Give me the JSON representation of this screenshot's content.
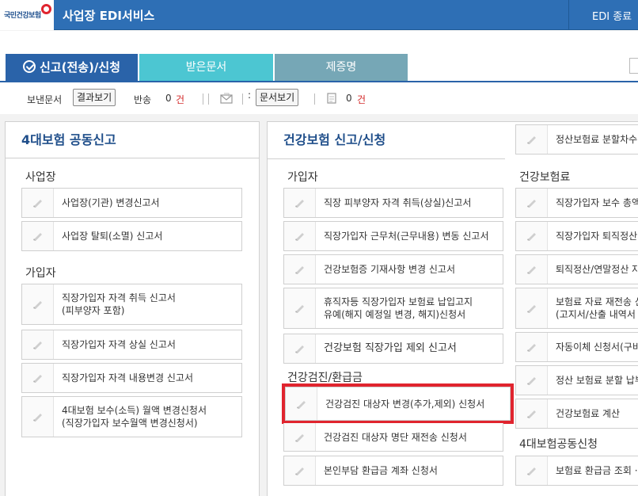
{
  "header": {
    "logo_text": "국민건강보험",
    "app_title": "사업장 EDI서비스",
    "logout_label": "EDI 종료"
  },
  "tabs": [
    {
      "label": "신고(전송)/신청",
      "active": true
    },
    {
      "label": "받은문서",
      "active": false
    },
    {
      "label": "제증명",
      "active": false
    }
  ],
  "toolbar": {
    "sent_docs_label": "보낸문서",
    "view_results_label": "결과보기",
    "returned_label": "반송",
    "returned_count": "0",
    "count_unit": "건",
    "view_docs_label": "문서보기",
    "other_count": "0"
  },
  "left_panel": {
    "title": "4대보험 공동신고",
    "sections": [
      {
        "title": "사업장",
        "items": [
          "사업장(기관) 변경신고서",
          "사업장 탈퇴(소멸) 신고서"
        ]
      },
      {
        "title": "가입자",
        "items": [
          "직장가입자 자격 취득 신고서\n(피부양자 포함)",
          "직장가입자 자격 상실 신고서",
          "직장가입자 자격 내용변경 신고서",
          "4대보험 보수(소득) 월액 변경신청서\n(직장가입자 보수월액 변경신청서)"
        ]
      }
    ]
  },
  "mid_panel": {
    "title": "건강보험 신고/신청",
    "col1": [
      {
        "title": "가입자",
        "items": [
          "직장 피부양자 자격 취득(상실)신고서",
          "직장가입자 근무처(근무내용) 변동 신고서",
          "건강보험증 기재사항 변경 신고서",
          "휴직자등 직장가입자 보험료 납입고지\n유예(해지 예정일 변경, 해지)신청서",
          "건강보험 직장가입 제외 신고서"
        ]
      },
      {
        "title": "건강검진/환급금",
        "items": [
          "건강검진 대상자 변경(추가,제외) 신청서",
          "건강검진 대상자 명단 재전송 신청서",
          "본인부담 환급금 계좌 신청서"
        ]
      }
    ],
    "col2_top_item": "정산보험료 분할차수",
    "col2": [
      {
        "title": "건강보험료",
        "items": [
          "직장가입자 보수 총액",
          "직장가입자 퇴직정산",
          "퇴직정산/연말정산 자",
          "보험료 자료 재전송 신\n(고지서/산출 내역서",
          "자동이체 신청서(구비",
          "정산 보험료 분할 납부",
          "건강보험료 계산"
        ]
      },
      {
        "title": "4대보험공동신청",
        "items": [
          "보험료 환급금 조회 ·"
        ]
      }
    ]
  },
  "colors": {
    "header_bg": "#2e6fb5",
    "tab_active": "#2a63a9",
    "tab_received": "#4cc6d2",
    "tab_cert": "#76a7b6",
    "panel_title": "#1f4e8a",
    "highlight": "#e0242e",
    "count_red": "#d42a2a"
  }
}
